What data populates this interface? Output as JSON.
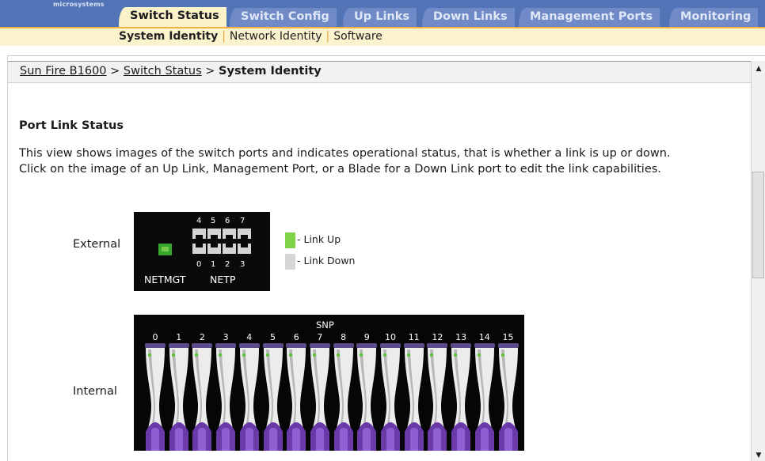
{
  "header": {
    "brand": "microsystems",
    "tabs": [
      {
        "label": "Switch Status",
        "active": true
      },
      {
        "label": "Switch Config",
        "active": false
      },
      {
        "label": "Up Links",
        "active": false
      },
      {
        "label": "Down Links",
        "active": false
      },
      {
        "label": "Management Ports",
        "active": false
      },
      {
        "label": "Monitoring",
        "active": false
      }
    ],
    "subnav": {
      "items": [
        {
          "label": "System Identity",
          "active": true
        },
        {
          "label": "Network Identity",
          "active": false
        },
        {
          "label": "Software",
          "active": false
        }
      ],
      "separator": "|"
    }
  },
  "breadcrumb": {
    "items": [
      {
        "label": "Sun Fire B1600",
        "link": true
      },
      {
        "label": "Switch Status",
        "link": true
      },
      {
        "label": "System Identity",
        "link": false
      }
    ],
    "separator": ">"
  },
  "main": {
    "heading": "Port Link Status",
    "description_line1": "This view shows images of the switch ports and indicates operational status, that is whether a link is up or down.",
    "description_line2": "Click on the image of an Up Link, Management Port, or a Blade for a Down Link port to edit the link capabilities.",
    "external": {
      "label": "External",
      "top_ports": [
        "4",
        "5",
        "6",
        "7"
      ],
      "bottom_ports": [
        "0",
        "1",
        "2",
        "3"
      ],
      "mgmt_label": "NETMGT",
      "netp_label": "NETP"
    },
    "legend": {
      "up_label": "- Link Up",
      "down_label": "- Link Down"
    },
    "internal": {
      "label": "Internal",
      "title": "SNP",
      "slots": [
        "0",
        "1",
        "2",
        "3",
        "4",
        "5",
        "6",
        "7",
        "8",
        "9",
        "10",
        "11",
        "12",
        "13",
        "14",
        "15"
      ]
    }
  },
  "colors": {
    "tab_bar": "#5273b5",
    "tab_active_bg": "#fbf2c9",
    "tab_stripe": "#f4b33f",
    "link_up": "#7ed34a",
    "link_down": "#d6d6d6",
    "blade_purple": "#6a3aa8"
  },
  "icons": {
    "scroll_up": "scroll-up-arrow-icon",
    "scroll_down": "scroll-down-arrow-icon"
  }
}
